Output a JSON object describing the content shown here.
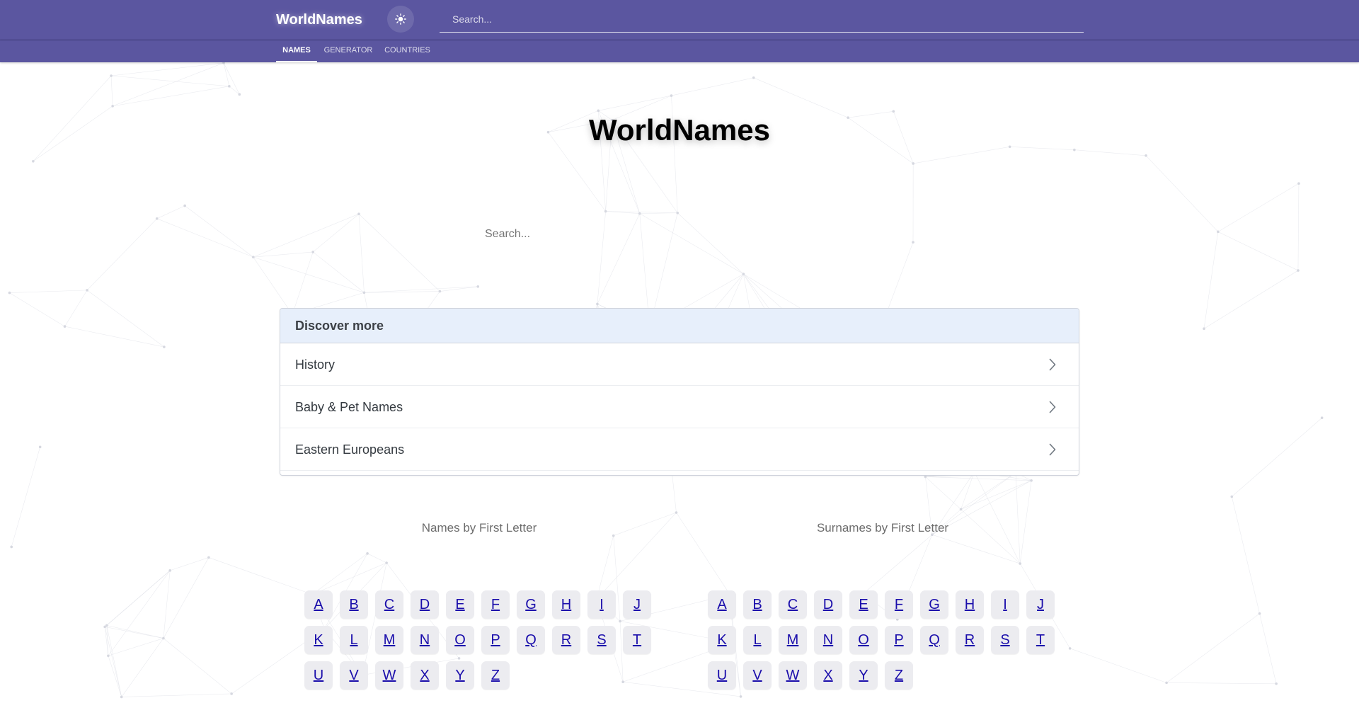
{
  "header": {
    "brand": "WorldNames",
    "theme_icon": "sun-icon",
    "search_placeholder": "Search..."
  },
  "tabs": [
    {
      "label": "NAMES",
      "active": true
    },
    {
      "label": "GENERATOR",
      "active": false
    },
    {
      "label": "COUNTRIES",
      "active": false
    }
  ],
  "hero": {
    "title": "WorldNames",
    "search_placeholder": "Search..."
  },
  "discover": {
    "title": "Discover more",
    "items": [
      "History",
      "Baby & Pet Names",
      "Eastern Europeans"
    ],
    "item_icon": "chevron-right-icon"
  },
  "names_by_letter": {
    "title": "Names by First Letter",
    "letters": [
      "A",
      "B",
      "C",
      "D",
      "E",
      "F",
      "G",
      "H",
      "I",
      "J",
      "K",
      "L",
      "M",
      "N",
      "O",
      "P",
      "Q",
      "R",
      "S",
      "T",
      "U",
      "V",
      "W",
      "X",
      "Y",
      "Z"
    ]
  },
  "surnames_by_letter": {
    "title": "Surnames by First Letter",
    "letters": [
      "A",
      "B",
      "C",
      "D",
      "E",
      "F",
      "G",
      "H",
      "I",
      "J",
      "K",
      "L",
      "M",
      "N",
      "O",
      "P",
      "Q",
      "R",
      "S",
      "T",
      "U",
      "V",
      "W",
      "X",
      "Y",
      "Z"
    ]
  },
  "colors": {
    "header_bg": "#5b56a0",
    "link": "#1a0dab",
    "card_header_bg": "#e7effb",
    "letter_bg": "#ececf0"
  }
}
